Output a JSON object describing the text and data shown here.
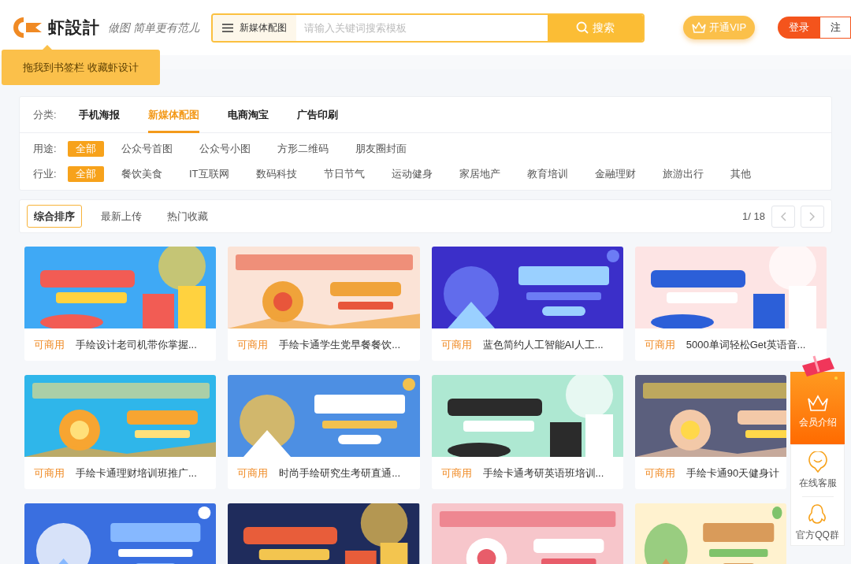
{
  "header": {
    "logo_text": "虾設計",
    "slogan": "做图 简单更有范儿",
    "search": {
      "category": "新媒体配图",
      "placeholder": "请输入关键词搜索模板",
      "button": "搜索"
    },
    "vip_button": "开通VIP",
    "login_button": "登录",
    "register_button": "注"
  },
  "bookmark_tip": "拖我到书签栏 收藏虾设计",
  "filters": {
    "category": {
      "label": "分类:",
      "options": [
        {
          "text": "手机海报",
          "selected": false
        },
        {
          "text": "新媒体配图",
          "selected": true
        },
        {
          "text": "电商淘宝",
          "selected": false
        },
        {
          "text": "广告印刷",
          "selected": false
        }
      ]
    },
    "groups": [
      {
        "label": "用途:",
        "options": [
          {
            "text": "全部",
            "selected": true
          },
          {
            "text": "公众号首图",
            "selected": false
          },
          {
            "text": "公众号小图",
            "selected": false
          },
          {
            "text": "方形二维码",
            "selected": false
          },
          {
            "text": "朋友圈封面",
            "selected": false
          }
        ]
      },
      {
        "label": "行业:",
        "options": [
          {
            "text": "全部",
            "selected": true
          },
          {
            "text": "餐饮美食",
            "selected": false
          },
          {
            "text": "IT互联网",
            "selected": false
          },
          {
            "text": "数码科技",
            "selected": false
          },
          {
            "text": "节日节气",
            "selected": false
          },
          {
            "text": "运动健身",
            "selected": false
          },
          {
            "text": "家居地产",
            "selected": false
          },
          {
            "text": "教育培训",
            "selected": false
          },
          {
            "text": "金融理财",
            "selected": false
          },
          {
            "text": "旅游出行",
            "selected": false
          },
          {
            "text": "其他",
            "selected": false
          }
        ]
      }
    ]
  },
  "sort": {
    "options": [
      {
        "text": "综合排序",
        "selected": true
      },
      {
        "text": "最新上传",
        "selected": false
      },
      {
        "text": "热门收藏",
        "selected": false
      }
    ],
    "page": "1/ 18"
  },
  "cards": [
    {
      "license": "可商用",
      "title": "手绘设计老司机带你掌握..."
    },
    {
      "license": "可商用",
      "title": "手绘卡通学生党早餐餐饮..."
    },
    {
      "license": "可商用",
      "title": "蓝色简约人工智能AI人工..."
    },
    {
      "license": "可商用",
      "title": "5000单词轻松Get英语音..."
    },
    {
      "license": "可商用",
      "title": "手绘卡通理财培训班推广..."
    },
    {
      "license": "可商用",
      "title": "时尚手绘研究生考研直通..."
    },
    {
      "license": "可商用",
      "title": "手绘卡通考研英语班培训..."
    },
    {
      "license": "可商用",
      "title": "手绘卡通90天健身计"
    },
    {
      "kind": "picture"
    },
    {
      "kind": "picture"
    },
    {
      "kind": "picture"
    },
    {
      "kind": "picture"
    }
  ],
  "side_panel": {
    "member": "会员介绍",
    "service": "在线客服",
    "qq_group": "官方QQ群"
  }
}
